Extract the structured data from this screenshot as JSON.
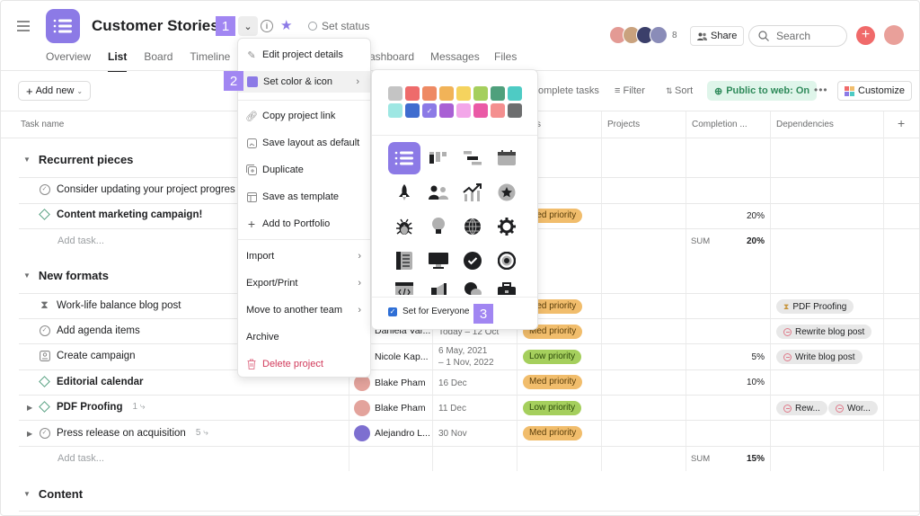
{
  "header": {
    "title": "Customer Stories - ",
    "set_status": "Set status",
    "member_count": "8",
    "share_label": "Share",
    "search_placeholder": "Search",
    "tabs": [
      "Overview",
      "List",
      "Board",
      "Timeline",
      "Dashboard",
      "Messages",
      "Files"
    ],
    "tab_dashboard_visible": "ashboard",
    "active_tab": "List"
  },
  "annotations": [
    "1",
    "2",
    "3"
  ],
  "toolbar": {
    "add_new": "Add new",
    "incomplete": "omplete tasks",
    "filter": "Filter",
    "sort": "Sort",
    "public": "Public to web: On",
    "more": "•••",
    "customize": "Customize"
  },
  "columns": {
    "task_name": "Task name",
    "status_partial": "s",
    "projects": "Projects",
    "completion": "Completion ...",
    "dependencies": "Dependencies",
    "add": "+"
  },
  "sections": [
    {
      "name": "Recurrent pieces",
      "rows": [
        {
          "name": "Consider updating your project progres",
          "icon": "check-circle-icon",
          "bold": false
        },
        {
          "name": "Content marketing campaign!",
          "icon": "milestone-diamond-icon",
          "bold": true,
          "priority": "Med priority",
          "completion": "20%"
        }
      ],
      "add_task": "Add task...",
      "sum_label": "SUM",
      "sum": "20%"
    },
    {
      "name": "New formats",
      "rows": [
        {
          "name": "Work-life balance blog post",
          "icon": "hourglass-icon",
          "bold": false,
          "priority": "Med priority",
          "dependency": "PDF Proofing"
        },
        {
          "name": "Add agenda items",
          "icon": "check-circle-icon",
          "bold": false,
          "assignee": "Daniela Var...",
          "date": "Today – 12 Oct",
          "priority": "Med priority",
          "dependency": "Rewrite blog post"
        },
        {
          "name": "Create campaign",
          "icon": "approval-icon",
          "bold": false,
          "assignee": "Nicole Kap...",
          "date_line1": "6 May, 2021",
          "date_line2": "– 1 Nov, 2022",
          "priority": "Low priority",
          "completion": "5%",
          "dependency": "Write blog post"
        },
        {
          "name": "Editorial calendar",
          "icon": "milestone-diamond-icon",
          "bold": true,
          "assignee": "Blake Pham",
          "date": "16 Dec",
          "priority": "Med priority",
          "completion": "10%"
        },
        {
          "name": "PDF Proofing",
          "icon": "milestone-diamond-icon",
          "bold": true,
          "subtasks": "1",
          "assignee": "Blake Pham",
          "date": "11 Dec",
          "priority": "Low priority",
          "dependencies": [
            "Rew...",
            "Wor..."
          ]
        },
        {
          "name": "Press release on acquisition",
          "icon": "check-circle-icon",
          "bold": false,
          "subtasks": "5",
          "assignee": "Alejandro L...",
          "date": "30 Nov",
          "priority": "Med priority"
        }
      ],
      "add_task": "Add task...",
      "sum_label": "SUM",
      "sum": "15%"
    },
    {
      "name": "Content"
    }
  ],
  "menu": {
    "items": [
      {
        "label": "Edit project details",
        "icon": "pencil-icon"
      },
      {
        "label": "Set color & icon",
        "icon": "color-swatch-icon",
        "submenu": true
      },
      {
        "label": "Copy project link",
        "icon": "link-icon"
      },
      {
        "label": "Save layout as default",
        "icon": "layout-icon"
      },
      {
        "label": "Duplicate",
        "icon": "duplicate-icon"
      },
      {
        "label": "Save as template",
        "icon": "template-icon"
      },
      {
        "label": "Add to Portfolio",
        "icon": "plus-icon"
      },
      {
        "label": "Import",
        "submenu": true
      },
      {
        "label": "Export/Print",
        "submenu": true
      },
      {
        "label": "Move to another team",
        "submenu": true
      },
      {
        "label": "Archive"
      },
      {
        "label": "Delete project",
        "icon": "trash-icon"
      }
    ]
  },
  "color_picker": {
    "colors": [
      "#c4c4c4",
      "#ee6b6b",
      "#ee8a64",
      "#f1b358",
      "#f5d35e",
      "#a5cf5d",
      "#4fa07c",
      "#4ecbc4",
      "#9ee7e3",
      "#3f6ccf",
      "#8c7ae6",
      "#a960d4",
      "#f3a6e9",
      "#ea5aa6",
      "#f48f8f",
      "#6d6e6f"
    ],
    "selected_index": 10,
    "icons": [
      "list-icon",
      "board-icon",
      "timeline-icon",
      "calendar-icon",
      "rocket-icon",
      "people-icon",
      "trending-icon",
      "star-badge-icon",
      "bug-icon",
      "lightbulb-icon",
      "globe-icon",
      "gear-icon",
      "checklist-icon",
      "computer-icon",
      "check-icon",
      "target-icon",
      "code-icon",
      "megaphone-icon",
      "chat-icon",
      "briefcase-icon"
    ],
    "selected_icon": "list-icon",
    "set_for_everyone": "Set for Everyone",
    "set_for_everyone_checked": true
  },
  "colors": {
    "accent": "#8c7ae6",
    "annotation": "#a186f2",
    "med_priority": "#f1bd6c",
    "low_priority": "#a5cf5d",
    "public_bg": "#dff5ea",
    "danger": "#d1395a"
  }
}
